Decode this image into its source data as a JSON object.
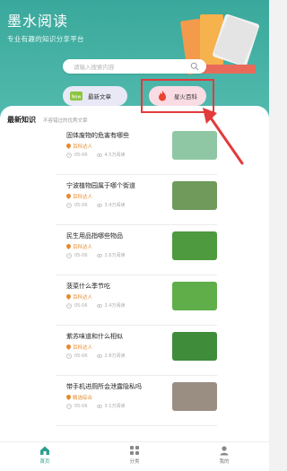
{
  "header": {
    "title": "墨水阅读",
    "slogan": "专业有趣的知识分享平台"
  },
  "search": {
    "placeholder": "请输入搜索内容"
  },
  "tabs": [
    {
      "label": "最新文章",
      "badge": "New"
    },
    {
      "label": "星火百科"
    }
  ],
  "section": {
    "title": "最新知识",
    "subtitle": "不容错过的优秀文章"
  },
  "articles": [
    {
      "title": "固体废物的危害有哪些",
      "tag": "百科达人",
      "date": "05-06",
      "views": "4.5万阅读",
      "thumb_color": "#8fc7a5"
    },
    {
      "title": "宁波植物园属于哪个街道",
      "tag": "百科达人",
      "date": "05-06",
      "views": "3.4万阅读",
      "thumb_color": "#6f9a5c"
    },
    {
      "title": "民生用品指哪些物品",
      "tag": "百科达人",
      "date": "05-06",
      "views": "2.6万阅读",
      "thumb_color": "#4e9a3f"
    },
    {
      "title": "菠菜什么季节吃",
      "tag": "百科达人",
      "date": "05-06",
      "views": "3.4万阅读",
      "thumb_color": "#5fae4a"
    },
    {
      "title": "紫苏味道和什么相似",
      "tag": "百科达人",
      "date": "05-06",
      "views": "2.8万阅读",
      "thumb_color": "#3f8c3a"
    },
    {
      "title": "带手机进厕所会泄露隐私吗",
      "tag": "精选综合",
      "date": "05-06",
      "views": "3.1万阅读",
      "thumb_color": "#9a8e82"
    }
  ],
  "bottom_nav": [
    {
      "label": "首页"
    },
    {
      "label": "分类"
    },
    {
      "label": "我的"
    }
  ],
  "colors": {
    "header": "#3aa89c",
    "accent": "#2e9e91",
    "tag": "#e58a2b",
    "highlight": "#e23b3b"
  }
}
